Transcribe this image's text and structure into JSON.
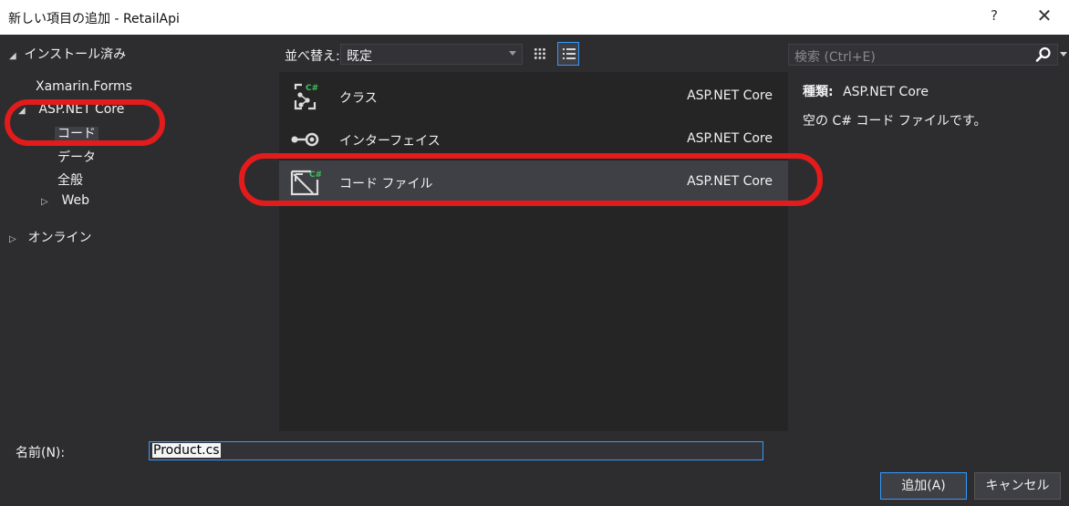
{
  "window": {
    "title": "新しい項目の追加 - RetailApi",
    "help_label": "?",
    "close_label": "✕"
  },
  "tree": {
    "installed": "インストール済み",
    "xamarin": "Xamarin.Forms",
    "aspnet": "ASP.NET Core",
    "code": "コード",
    "data": "データ",
    "general": "全般",
    "web": "Web",
    "online": "オンライン"
  },
  "toolbar": {
    "sort_label": "並べ替え:",
    "sort_value": "既定"
  },
  "search": {
    "placeholder": "検索 (Ctrl+E)"
  },
  "items": [
    {
      "name": "クラス",
      "category": "ASP.NET Core",
      "icon": "csharp-class-icon"
    },
    {
      "name": "インターフェイス",
      "category": "ASP.NET Core",
      "icon": "interface-icon"
    },
    {
      "name": "コード ファイル",
      "category": "ASP.NET Core",
      "icon": "csharp-code-file-icon"
    }
  ],
  "detail": {
    "type_key": "種類:",
    "type_value": "ASP.NET Core",
    "description": "空の C# コード ファイルです。"
  },
  "footer": {
    "name_label": "名前(N):",
    "name_value": "Product.cs",
    "add_label": "追加(A)",
    "cancel_label": "キャンセル"
  },
  "colors": {
    "accent": "#3399ff",
    "annotation": "#e31b1b",
    "csharp_green": "#3ec05a"
  }
}
